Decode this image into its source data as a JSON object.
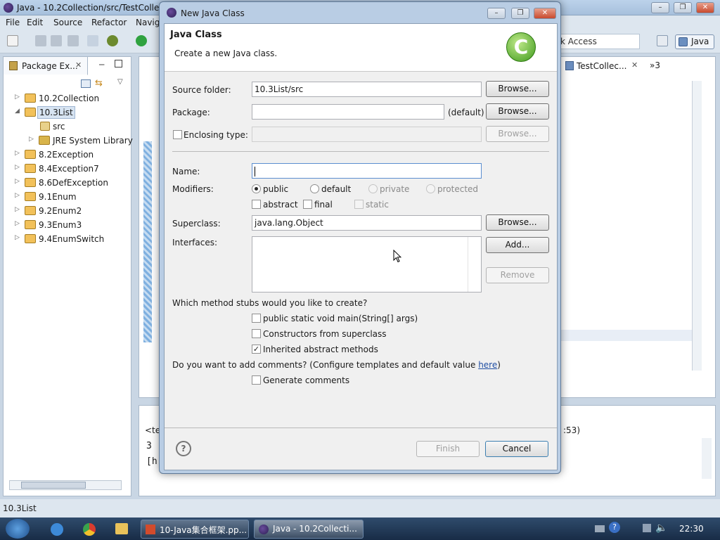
{
  "main_window": {
    "title": "Java - 10.2Collection/src/TestCollec",
    "menu": [
      "File",
      "Edit",
      "Source",
      "Refactor",
      "Navig"
    ],
    "quick_access": "k Access",
    "perspective": "Java"
  },
  "package_explorer": {
    "tab_label": "Package Ex...",
    "items": [
      {
        "label": "10.2Collection"
      },
      {
        "label": "10.3List"
      },
      {
        "label": "src"
      },
      {
        "label": "JRE System Library"
      },
      {
        "label": "8.2Exception"
      },
      {
        "label": "8.4Exception7"
      },
      {
        "label": "8.6DefException"
      },
      {
        "label": "9.1Enum"
      },
      {
        "label": "9.2Enum2"
      },
      {
        "label": "9.3Enum3"
      },
      {
        "label": "9.4EnumSwitch"
      }
    ]
  },
  "right_tab": {
    "label": "TestCollec...",
    "overflow": "»3"
  },
  "console": {
    "head": "<ter",
    "time": ":53)",
    "lines": [
      "3",
      "[h"
    ]
  },
  "status": {
    "text": "10.3List"
  },
  "taskbar": {
    "items": [
      "10-Java集合框架.pp...",
      "Java - 10.2Collecti..."
    ],
    "clock": "22:30"
  },
  "dialog": {
    "title": "New Java Class",
    "header_title": "Java Class",
    "header_desc": "Create a new Java class.",
    "source_folder": {
      "label": "Source folder:",
      "value": "10.3List/src",
      "button": "Browse..."
    },
    "package": {
      "label": "Package:",
      "value": "",
      "default_text": "(default)",
      "button": "Browse..."
    },
    "enclosing": {
      "label": "Enclosing type:",
      "value": "",
      "button": "Browse..."
    },
    "name": {
      "label": "Name:",
      "value": ""
    },
    "modifiers": {
      "label": "Modifiers:",
      "access": [
        "public",
        "default",
        "private",
        "protected"
      ],
      "selected": "public",
      "others": [
        "abstract",
        "final",
        "static"
      ]
    },
    "superclass": {
      "label": "Superclass:",
      "value": "java.lang.Object",
      "button": "Browse..."
    },
    "interfaces": {
      "label": "Interfaces:",
      "add_button": "Add...",
      "remove_button": "Remove"
    },
    "stubs": {
      "question": "Which method stubs would you like to create?",
      "options": [
        {
          "label": "public static void main(String[] args)",
          "checked": false
        },
        {
          "label": "Constructors from superclass",
          "checked": false
        },
        {
          "label": "Inherited abstract methods",
          "checked": true
        }
      ]
    },
    "comments": {
      "question": "Do you want to add comments? (Configure templates and default value ",
      "link": "here",
      "close": ")",
      "option": "Generate comments"
    },
    "help": "?",
    "finish": "Finish",
    "cancel": "Cancel"
  }
}
